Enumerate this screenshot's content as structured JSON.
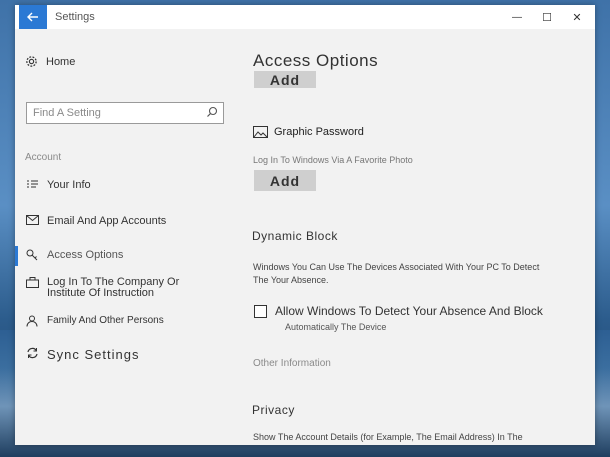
{
  "window": {
    "title": "Settings",
    "minimize": "—",
    "maximize": "☐",
    "close": "✕"
  },
  "sidebar": {
    "home_label": "Home",
    "search_placeholder": "Find A Setting",
    "section_label": "Account",
    "items": [
      {
        "label": "Your Info"
      },
      {
        "label": "Email And App Accounts"
      },
      {
        "label": "Access Options"
      },
      {
        "label": "Log In To The Company Or Institute Of Instruction"
      },
      {
        "label": "Family And Other Persons"
      },
      {
        "label": "Sync Settings"
      }
    ]
  },
  "main": {
    "title": "Access Options",
    "add_button_top": "Add",
    "graphic_password": {
      "title": "Graphic Password",
      "description": "Log In To Windows Via A Favorite Photo",
      "button": "Add"
    },
    "dynamic_block": {
      "title": "Dynamic Block",
      "description": "Windows You Can Use The Devices Associated With Your PC To Detect The Your Absence.",
      "checkbox_label": "Allow Windows To Detect Your Absence And Block",
      "checkbox_sub": "Automatically The Device",
      "checkbox_checked": false
    },
    "other_information": "Other Information",
    "privacy": {
      "title": "Privacy",
      "description": "Show The Account Details (for Example, The Email Address) In The"
    }
  }
}
